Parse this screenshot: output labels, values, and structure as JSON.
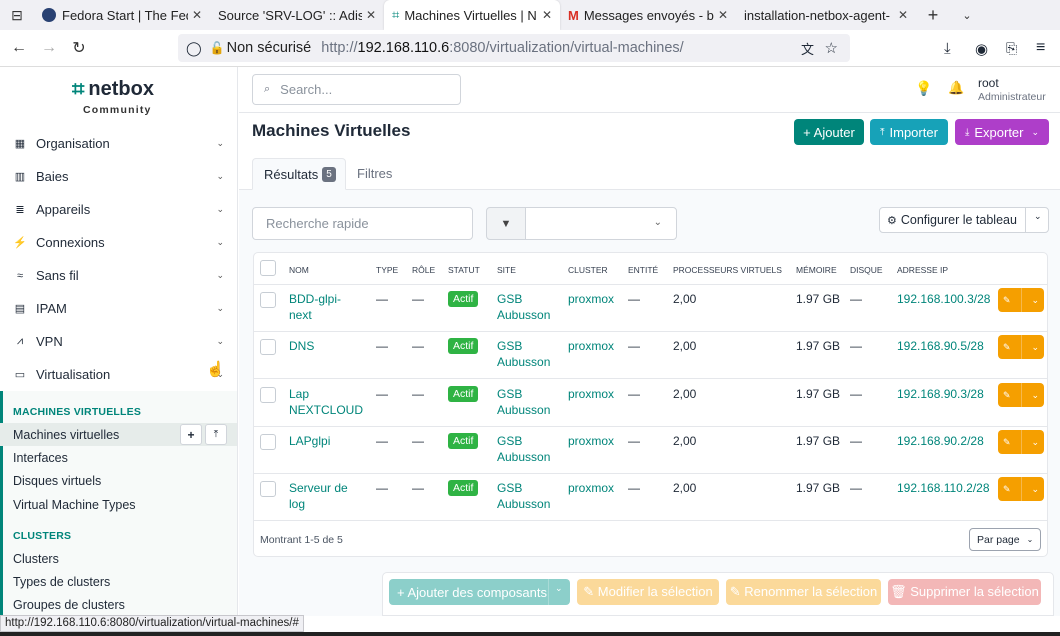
{
  "browser": {
    "tabs": [
      {
        "title": "Fedora Start | The Fedo",
        "active": false
      },
      {
        "title": "Source 'SRV-LOG' :: Adisc",
        "active": false
      },
      {
        "title": "Machines Virtuelles | N",
        "active": true
      },
      {
        "title": "Messages envoyés - b",
        "active": false
      },
      {
        "title": "installation-netbox-agent-",
        "active": false
      }
    ],
    "security_label": "Non sécurisé",
    "url_prefix": "http://",
    "url_host": "192.168.110.6",
    "url_rest": ":8080/virtualization/virtual-machines/",
    "status_url": "http://192.168.110.6:8080/virtualization/virtual-machines/#"
  },
  "brand": {
    "name": "netbox",
    "edition": "Community"
  },
  "sidebar": {
    "items": [
      {
        "label": "Organisation",
        "icon": "building-icon"
      },
      {
        "label": "Baies",
        "icon": "rack-icon"
      },
      {
        "label": "Appareils",
        "icon": "server-icon"
      },
      {
        "label": "Connexions",
        "icon": "plug-icon"
      },
      {
        "label": "Sans fil",
        "icon": "wifi-icon"
      },
      {
        "label": "IPAM",
        "icon": "counter-icon"
      },
      {
        "label": "VPN",
        "icon": "tunnel-icon"
      },
      {
        "label": "Virtualisation",
        "icon": "monitor-icon"
      }
    ],
    "sections": [
      {
        "title": "MACHINES VIRTUELLES",
        "links": [
          "Machines virtuelles",
          "Interfaces",
          "Disques virtuels",
          "Virtual Machine Types"
        ]
      },
      {
        "title": "CLUSTERS",
        "links": [
          "Clusters",
          "Types de clusters",
          "Groupes de clusters"
        ]
      }
    ]
  },
  "header": {
    "search_placeholder": "Search...",
    "user_name": "root",
    "user_role": "Administrateur"
  },
  "page": {
    "title": "Machines Virtuelles",
    "add_label": "+ Ajouter",
    "import_label": "Importer",
    "export_label": "Exporter",
    "tabs": [
      {
        "label": "Résultats",
        "count": "5"
      },
      {
        "label": "Filtres"
      }
    ],
    "quick_search_placeholder": "Recherche rapide",
    "configure_label": "Configurer le tableau"
  },
  "table": {
    "columns": [
      "Nom",
      "Type",
      "Rôle",
      "Statut",
      "Site",
      "Cluster",
      "Entité",
      "Processeurs virtuels",
      "Mémoire",
      "Disque",
      "Adresse IP"
    ],
    "rows": [
      {
        "name": [
          "BDD-glpi-",
          "next"
        ],
        "type": "—",
        "role": "—",
        "status": "Actif",
        "site": [
          "GSB",
          "Aubusson"
        ],
        "cluster": "proxmox",
        "tenant": "—",
        "vcpus": "2,00",
        "memory": "1.97 GB",
        "disk": "—",
        "ip": "192.168.100.3/28"
      },
      {
        "name": [
          "DNS",
          ""
        ],
        "type": "—",
        "role": "—",
        "status": "Actif",
        "site": [
          "GSB",
          "Aubusson"
        ],
        "cluster": "proxmox",
        "tenant": "—",
        "vcpus": "2,00",
        "memory": "1.97 GB",
        "disk": "—",
        "ip": "192.168.90.5/28"
      },
      {
        "name": [
          "Lap",
          "NEXTCLOUD"
        ],
        "type": "—",
        "role": "—",
        "status": "Actif",
        "site": [
          "GSB",
          "Aubusson"
        ],
        "cluster": "proxmox",
        "tenant": "—",
        "vcpus": "2,00",
        "memory": "1.97 GB",
        "disk": "—",
        "ip": "192.168.90.3/28"
      },
      {
        "name": [
          "LAPglpi",
          ""
        ],
        "type": "—",
        "role": "—",
        "status": "Actif",
        "site": [
          "GSB",
          "Aubusson"
        ],
        "cluster": "proxmox",
        "tenant": "—",
        "vcpus": "2,00",
        "memory": "1.97 GB",
        "disk": "—",
        "ip": "192.168.90.2/28"
      },
      {
        "name": [
          "Serveur de",
          "log"
        ],
        "type": "—",
        "role": "—",
        "status": "Actif",
        "site": [
          "GSB",
          "Aubusson"
        ],
        "cluster": "proxmox",
        "tenant": "—",
        "vcpus": "2,00",
        "memory": "1.97 GB",
        "disk": "—",
        "ip": "192.168.110.2/28"
      }
    ],
    "footer_text": "Montrant 1-5 de 5",
    "per_page_label": "Par page"
  },
  "bulk": {
    "add_components": "+ Ajouter des composants",
    "edit": "✎ Modifier la sélection",
    "rename": "✎ Renommer la sélection",
    "delete": "🗑 Supprimer la sélection"
  },
  "colors": {
    "accent": "#00857a",
    "info": "#17a2b8",
    "purple": "#ae3ec9",
    "warning": "#f59f00",
    "success": "#2fb344"
  }
}
